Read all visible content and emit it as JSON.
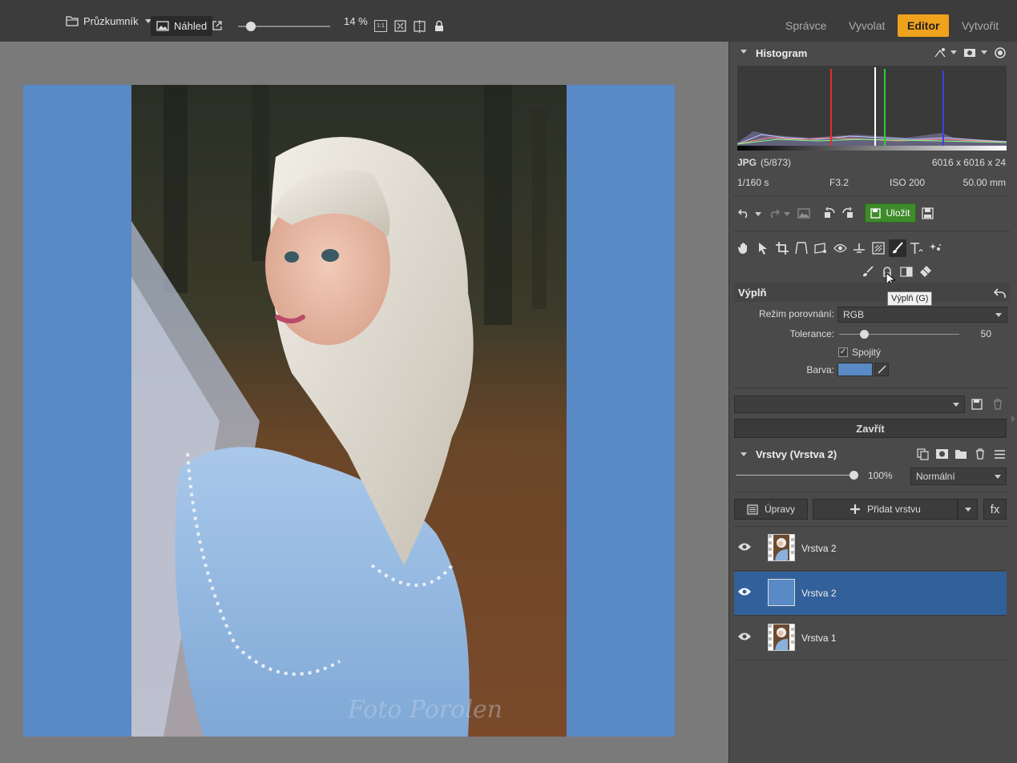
{
  "toolbar": {
    "explorer_label": "Průzkumník",
    "preview_label": "Náhled",
    "zoom_value": 0.14,
    "zoom_label": "14 %",
    "ratio_label": "1:1"
  },
  "tabs": [
    {
      "label": "Správce"
    },
    {
      "label": "Vyvolat"
    },
    {
      "label": "Editor",
      "active": true
    },
    {
      "label": "Vytvořit"
    }
  ],
  "colors": {
    "accent": "#f0a21c",
    "fill_color": "#5a8ac6",
    "selection": "#32609a",
    "save_green": "#3f8a2a"
  },
  "histogram": {
    "title": "Histogram",
    "format": "JPG",
    "index": "(5/873)",
    "dimensions": "6016 x 6016 x 24",
    "shutter": "1/160 s",
    "aperture": "F3.2",
    "iso": "ISO 200",
    "focal": "50.00 mm"
  },
  "actions": {
    "save_label": "Uložit"
  },
  "fill_tool": {
    "title": "Výplň",
    "tooltip": "Výplň (G)",
    "compare_mode_label": "Režim porovnání:",
    "compare_mode_value": "RGB",
    "tolerance_label": "Tolerance:",
    "tolerance_value": "50",
    "contiguous_label": "Spojitý",
    "contiguous_checked": true,
    "color_label": "Barva:",
    "close_label": "Zavřít"
  },
  "layers": {
    "title": "Vrstvy (Vrstva 2)",
    "opacity_value": 1.0,
    "opacity_label": "100%",
    "blend_mode": "Normální",
    "adjust_label": "Úpravy",
    "add_layer_label": "Přidat vrstvu",
    "fx_label": "fx",
    "items": [
      {
        "name": "Vrstva 2",
        "thumb": "photo",
        "selected": false
      },
      {
        "name": "Vrstva 2",
        "thumb": "fill",
        "selected": true
      },
      {
        "name": "Vrstva 1",
        "thumb": "photo",
        "selected": false
      }
    ]
  },
  "photo": {
    "watermark": "Foto Porolen"
  }
}
